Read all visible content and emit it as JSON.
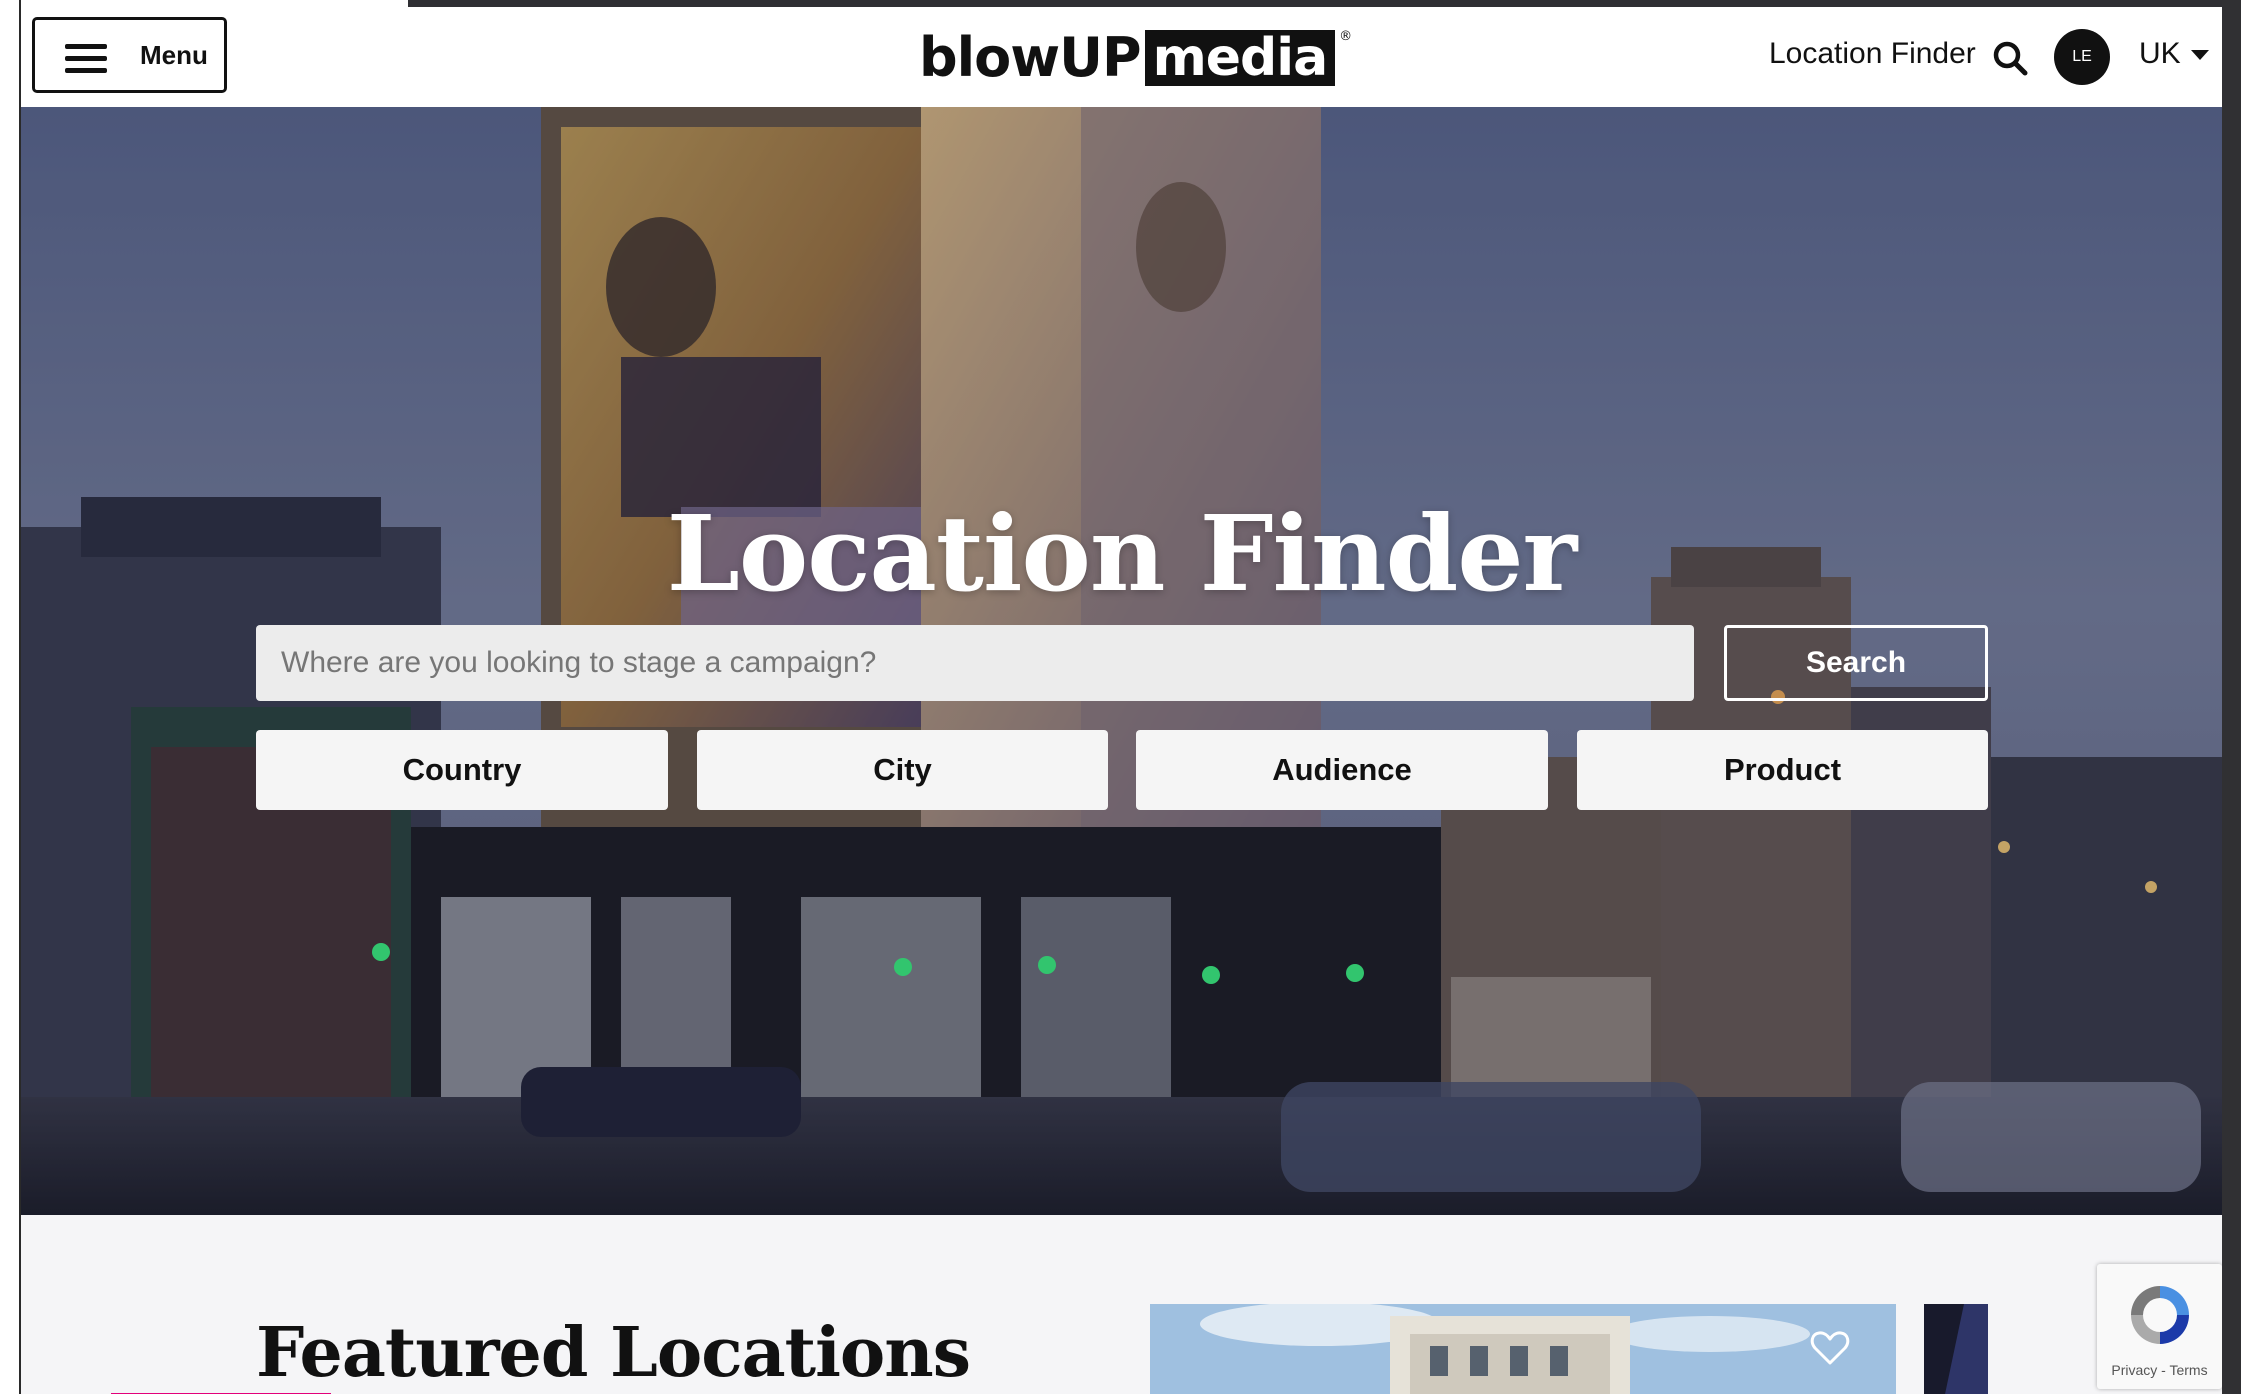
{
  "header": {
    "menu_label": "Menu",
    "logo": {
      "left": "blowUP",
      "right": "media",
      "reg": "®"
    },
    "location_finder_link": "Location Finder",
    "avatar_initials": "LE",
    "locale": "UK"
  },
  "hero": {
    "title": "Location Finder",
    "search_placeholder": "Where are you looking to stage a campaign?",
    "search_button": "Search",
    "filters": [
      "Country",
      "City",
      "Audience",
      "Product"
    ]
  },
  "featured": {
    "title": "Featured Locations"
  },
  "recaptcha": {
    "text": "Privacy - Terms"
  },
  "colors": {
    "accent": "#e2007a",
    "primary_text": "#111111",
    "button_bg": "#f5f5f5"
  },
  "icons": {
    "menu": "hamburger-icon",
    "search": "search-icon",
    "locale_caret": "chevron-down-icon",
    "favorite": "heart-icon",
    "recaptcha": "recaptcha-icon"
  }
}
